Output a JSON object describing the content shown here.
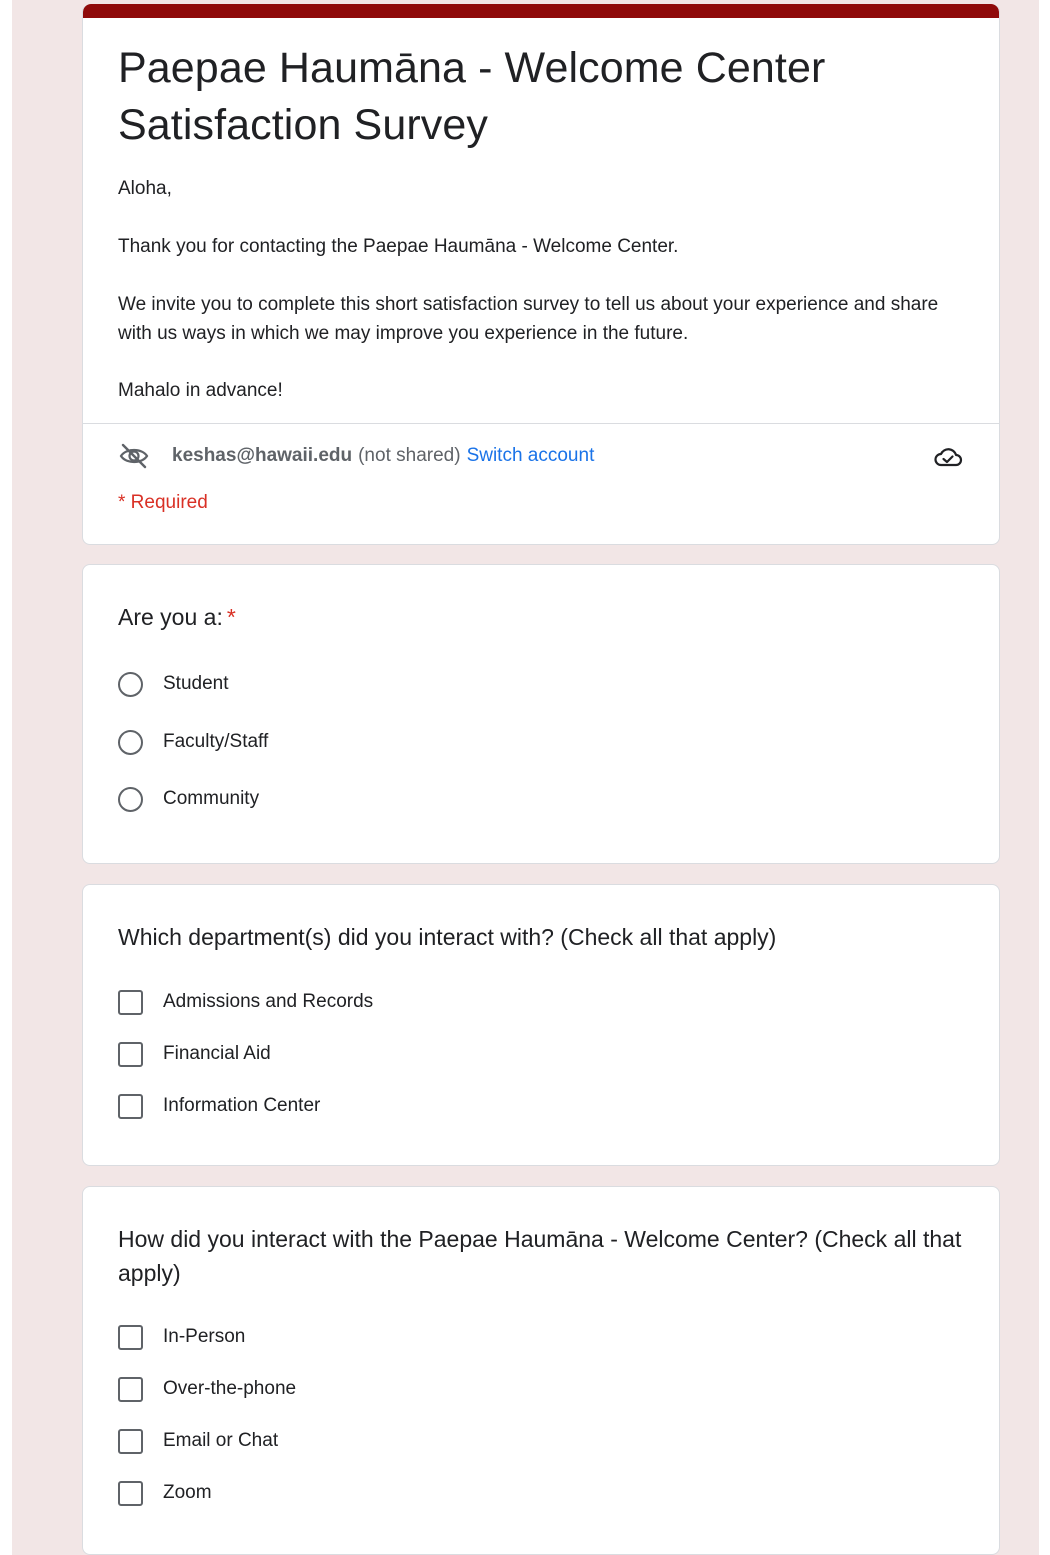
{
  "form": {
    "title": "Paepae Haumāna - Welcome Center Satisfaction Survey",
    "description": [
      "Aloha,",
      "Thank you for contacting the Paepae Haumāna - Welcome Center.",
      "We invite you to complete this short satisfaction survey to tell us about your experience and share with us ways in which we may improve you experience in the future.",
      "Mahalo in advance!"
    ],
    "account": {
      "email": "keshas@hawaii.edu",
      "not_shared": "(not shared)",
      "switch_label": "Switch account"
    },
    "required_note": "* Required"
  },
  "questions": [
    {
      "title": "Are you a:",
      "required_mark": "*",
      "type": "radio",
      "options": [
        "Student",
        "Faculty/Staff",
        "Community"
      ]
    },
    {
      "title": "Which department(s) did you interact with? (Check all that apply)",
      "type": "checkbox",
      "options": [
        "Admissions and Records",
        "Financial Aid",
        "Information Center"
      ]
    },
    {
      "title": "How did you interact with the Paepae Haumāna - Welcome Center? (Check all that apply)",
      "type": "checkbox",
      "options": [
        "In-Person",
        "Over-the-phone",
        "Email or Chat",
        "Zoom"
      ]
    }
  ],
  "colors": {
    "accent": "#8f0a0a",
    "background": "#f2e6e6",
    "link": "#1a73e8",
    "required": "#d93025"
  },
  "icons": [
    "eye-off-icon",
    "cloud-check-icon"
  ]
}
